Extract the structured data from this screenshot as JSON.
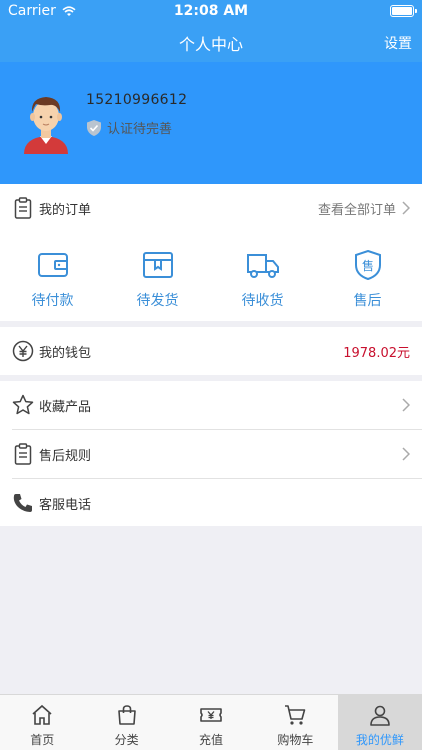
{
  "status_bar": {
    "carrier": "Carrier",
    "time": "12:08 AM"
  },
  "nav": {
    "title": "个人中心",
    "settings": "设置"
  },
  "profile": {
    "phone": "15210996612",
    "verify_status": "认证待完善"
  },
  "orders_row": {
    "label": "我的订单",
    "view_all": "查看全部订单"
  },
  "order_items": [
    {
      "label": "待付款",
      "icon": "wallet-icon"
    },
    {
      "label": "待发货",
      "icon": "package-icon"
    },
    {
      "label": "待收货",
      "icon": "truck-icon"
    },
    {
      "label": "售后",
      "icon": "after-sales-shield-icon"
    }
  ],
  "wallet": {
    "label": "我的钱包",
    "balance": "1978.02元"
  },
  "menu": [
    {
      "label": "收藏产品",
      "icon": "star-icon"
    },
    {
      "label": "售后规则",
      "icon": "clipboard-icon"
    },
    {
      "label": "客服电话",
      "icon": "phone-icon"
    }
  ],
  "tabs": [
    {
      "label": "首页",
      "icon": "home-icon"
    },
    {
      "label": "分类",
      "icon": "bag-icon"
    },
    {
      "label": "充值",
      "icon": "ticket-icon"
    },
    {
      "label": "购物车",
      "icon": "cart-icon"
    },
    {
      "label": "我的优鲜",
      "icon": "user-icon"
    }
  ],
  "colors": {
    "primary": "#2f97fb",
    "accent_text": "#3b8fd8",
    "balance": "#c8102e"
  }
}
